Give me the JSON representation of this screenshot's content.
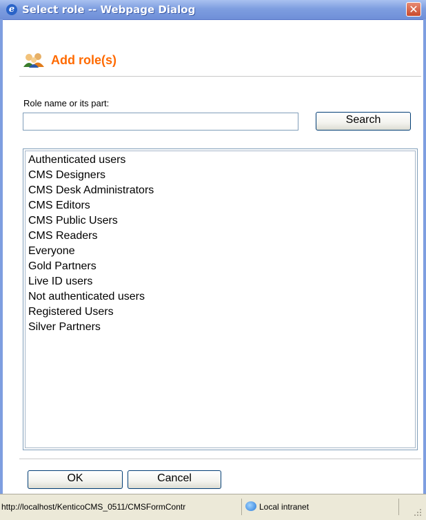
{
  "window": {
    "title": "Select role -- Webpage Dialog",
    "ie_icon": "ie-logo-icon",
    "close_icon": "close-icon",
    "close_glyph": "✕"
  },
  "header": {
    "title": "Add role(s)",
    "icon": "users-icon",
    "accent_color": "#ff6a00"
  },
  "search": {
    "label": "Role name or its part:",
    "value": "",
    "placeholder": "",
    "button_label": "Search"
  },
  "roles": [
    "Authenticated users",
    "CMS Designers",
    "CMS Desk Administrators",
    "CMS Editors",
    "CMS Public Users",
    "CMS Readers",
    "Everyone",
    "Gold Partners",
    "Live ID users",
    "Not authenticated users",
    "Registered Users",
    "Silver Partners"
  ],
  "footer": {
    "ok_label": "OK",
    "cancel_label": "Cancel"
  },
  "statusbar": {
    "url": "http://localhost/KenticoCMS_0511/CMSFormContr",
    "zone": "Local intranet",
    "zone_icon": "intranet-globe-icon"
  }
}
